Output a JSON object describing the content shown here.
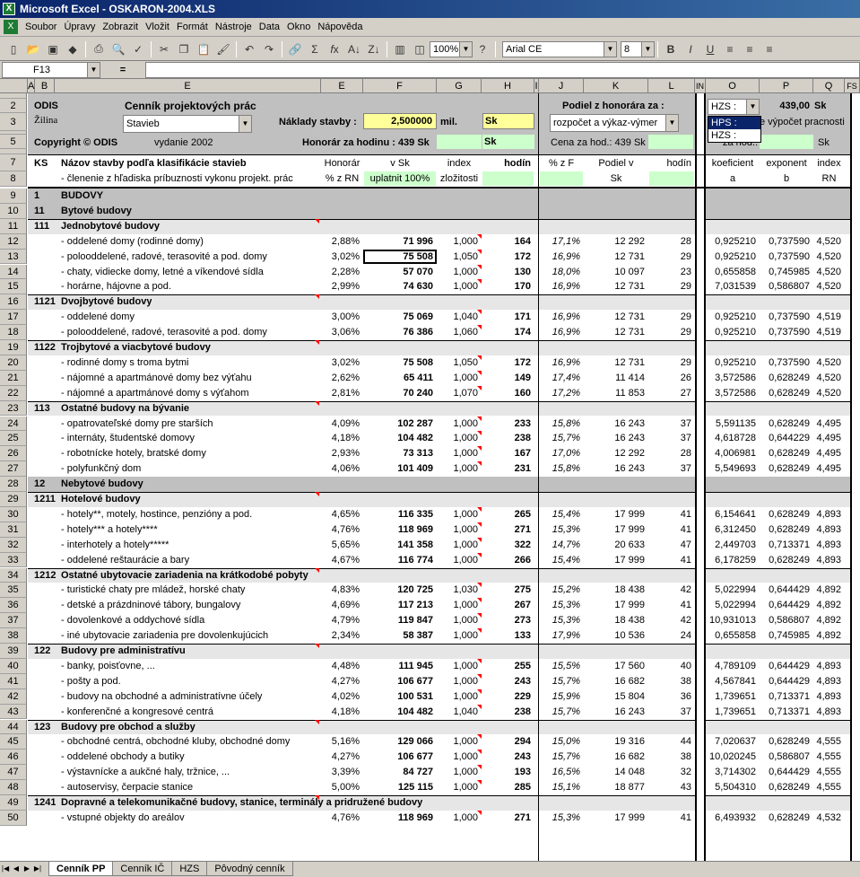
{
  "window": {
    "title": "Microsoft Excel - OSKARON-2004.XLS"
  },
  "menu": [
    "Soubor",
    "Úpravy",
    "Zobrazit",
    "Vložit",
    "Formát",
    "Nástroje",
    "Data",
    "Okno",
    "Nápověda"
  ],
  "toolbar": {
    "zoom": "100%",
    "font": "Arial CE",
    "size": "8"
  },
  "formula": {
    "cell_ref": "F13",
    "eq": "="
  },
  "columns": [
    "A",
    "B",
    "C",
    "D",
    "E",
    "F",
    "G",
    "H",
    "I",
    "J",
    "K",
    "L",
    "IN",
    "O",
    "P",
    "Q",
    "FS"
  ],
  "header": {
    "odis": "ODIS",
    "zilina": "Žilina",
    "cennik": "Cenník projektových prác",
    "stavieb": "Stavieb",
    "naklady_label": "Náklady stavby :",
    "naklady_value": "2,500000",
    "mil": "mil.",
    "sk": "Sk",
    "copyright": "Copyright © ODIS",
    "vydanie": "vydanie 2002",
    "honorar_label": "Honorár za hodinu : 439 Sk",
    "sk2": "Sk",
    "podiel_label": "Podiel z honorára za :",
    "podiel_value": "rozpočet a výkaz-výmer",
    "cena_label": "Cena za hod.: 439 Sk",
    "hzs_value": "HZS :",
    "hzs_price": "439,00",
    "hzs_sk": "Sk",
    "vypocet": "e výpočet pracnosti",
    "za_hod": "za hod.:",
    "sk3": "Sk",
    "dropdown_items": [
      "HPS :",
      "HZS :"
    ]
  },
  "colheads": {
    "ks": "KS",
    "nazov": "Názov stavby podľa klasifikácie stavieb",
    "clenenie": "- členenie z hľadiska príbuznosti vykonu projekt. prác",
    "honorar1": "Honorár",
    "honorar2": "% z RN",
    "vsk": "v Sk",
    "uplatnit": "uplatnit 100%",
    "index1": "index",
    "index2": "zložitosti",
    "hodin": "hodín",
    "pzf": "% z F",
    "podiel1": "Podiel v",
    "podiel2": "Sk",
    "hodin2": "hodín",
    "koef1": "koeficient",
    "koef2": "a",
    "exp1": "exponent",
    "exp2": "b",
    "ind1": "index",
    "ind2": "RN"
  },
  "rows": [
    {
      "n": "9",
      "t": "band",
      "ks": "1",
      "name": "BUDOVY"
    },
    {
      "n": "10",
      "t": "band",
      "ks": "11",
      "name": "Bytové budovy"
    },
    {
      "n": "11",
      "t": "group",
      "ks": "111",
      "name": "Jednobytové budovy"
    },
    {
      "n": "12",
      "t": "data",
      "name": "- oddelené domy (rodinné domy)",
      "e": "2,88%",
      "f": "71 996",
      "g": "1,000",
      "h": "164",
      "j": "17,1%",
      "k": "12 292",
      "l": "28",
      "o": "0,925210",
      "p": "0,737590",
      "q": "4,520"
    },
    {
      "n": "13",
      "t": "data",
      "name": "- polooddelené, radové, terasovité a pod. domy",
      "e": "3,02%",
      "f": "75 508",
      "g": "1,050",
      "h": "172",
      "j": "16,9%",
      "k": "12 731",
      "l": "29",
      "o": "0,925210",
      "p": "0,737590",
      "q": "4,520",
      "sel": true
    },
    {
      "n": "14",
      "t": "data",
      "name": "- chaty, vidiecke domy, letné a víkendové sídla",
      "e": "2,28%",
      "f": "57 070",
      "g": "1,000",
      "h": "130",
      "j": "18,0%",
      "k": "10 097",
      "l": "23",
      "o": "0,655858",
      "p": "0,745985",
      "q": "4,520"
    },
    {
      "n": "15",
      "t": "data",
      "name": "- horárne, hájovne a pod.",
      "e": "2,99%",
      "f": "74 630",
      "g": "1,000",
      "h": "170",
      "j": "16,9%",
      "k": "12 731",
      "l": "29",
      "o": "7,031539",
      "p": "0,586807",
      "q": "4,520"
    },
    {
      "n": "16",
      "t": "group",
      "ks": "1121",
      "name": "Dvojbytové budovy"
    },
    {
      "n": "17",
      "t": "data",
      "name": "- oddelené domy",
      "e": "3,00%",
      "f": "75 069",
      "g": "1,040",
      "h": "171",
      "j": "16,9%",
      "k": "12 731",
      "l": "29",
      "o": "0,925210",
      "p": "0,737590",
      "q": "4,519"
    },
    {
      "n": "18",
      "t": "data",
      "name": "- polooddelené, radové, terasovité a pod. domy",
      "e": "3,06%",
      "f": "76 386",
      "g": "1,060",
      "h": "174",
      "j": "16,9%",
      "k": "12 731",
      "l": "29",
      "o": "0,925210",
      "p": "0,737590",
      "q": "4,519"
    },
    {
      "n": "19",
      "t": "group",
      "ks": "1122",
      "name": "Trojbytové a viacbytové budovy"
    },
    {
      "n": "20",
      "t": "data",
      "name": "- rodinné domy s troma bytmi",
      "e": "3,02%",
      "f": "75 508",
      "g": "1,050",
      "h": "172",
      "j": "16,9%",
      "k": "12 731",
      "l": "29",
      "o": "0,925210",
      "p": "0,737590",
      "q": "4,520"
    },
    {
      "n": "21",
      "t": "data",
      "name": "- nájomné a apartmánové domy bez výťahu",
      "e": "2,62%",
      "f": "65 411",
      "g": "1,000",
      "h": "149",
      "j": "17,4%",
      "k": "11 414",
      "l": "26",
      "o": "3,572586",
      "p": "0,628249",
      "q": "4,520"
    },
    {
      "n": "22",
      "t": "data",
      "name": "- nájomné a apartmánové domy s výťahom",
      "e": "2,81%",
      "f": "70 240",
      "g": "1,070",
      "h": "160",
      "j": "17,2%",
      "k": "11 853",
      "l": "27",
      "o": "3,572586",
      "p": "0,628249",
      "q": "4,520"
    },
    {
      "n": "23",
      "t": "group",
      "ks": "113",
      "name": "Ostatné budovy na bývanie"
    },
    {
      "n": "24",
      "t": "data",
      "name": "- opatrovateľské domy pre starších",
      "e": "4,09%",
      "f": "102 287",
      "g": "1,000",
      "h": "233",
      "j": "15,8%",
      "k": "16 243",
      "l": "37",
      "o": "5,591135",
      "p": "0,628249",
      "q": "4,495"
    },
    {
      "n": "25",
      "t": "data",
      "name": "- internáty, študentské domovy",
      "e": "4,18%",
      "f": "104 482",
      "g": "1,000",
      "h": "238",
      "j": "15,7%",
      "k": "16 243",
      "l": "37",
      "o": "4,618728",
      "p": "0,644229",
      "q": "4,495"
    },
    {
      "n": "26",
      "t": "data",
      "name": "- robotnícke hotely, bratské domy",
      "e": "2,93%",
      "f": "73 313",
      "g": "1,000",
      "h": "167",
      "j": "17,0%",
      "k": "12 292",
      "l": "28",
      "o": "4,006981",
      "p": "0,628249",
      "q": "4,495"
    },
    {
      "n": "27",
      "t": "data",
      "name": "- polyfunkčný dom",
      "e": "4,06%",
      "f": "101 409",
      "g": "1,000",
      "h": "231",
      "j": "15,8%",
      "k": "16 243",
      "l": "37",
      "o": "5,549693",
      "p": "0,628249",
      "q": "4,495"
    },
    {
      "n": "28",
      "t": "band",
      "ks": "12",
      "name": "Nebytové budovy"
    },
    {
      "n": "29",
      "t": "group",
      "ks": "1211",
      "name": "Hotelové budovy"
    },
    {
      "n": "30",
      "t": "data",
      "name": "- hotely**, motely, hostince, penzióny a pod.",
      "e": "4,65%",
      "f": "116 335",
      "g": "1,000",
      "h": "265",
      "j": "15,4%",
      "k": "17 999",
      "l": "41",
      "o": "6,154641",
      "p": "0,628249",
      "q": "4,893"
    },
    {
      "n": "31",
      "t": "data",
      "name": "- hotely*** a hotely****",
      "e": "4,76%",
      "f": "118 969",
      "g": "1,000",
      "h": "271",
      "j": "15,3%",
      "k": "17 999",
      "l": "41",
      "o": "6,312450",
      "p": "0,628249",
      "q": "4,893"
    },
    {
      "n": "32",
      "t": "data",
      "name": "- interhotely a hotely*****",
      "e": "5,65%",
      "f": "141 358",
      "g": "1,000",
      "h": "322",
      "j": "14,7%",
      "k": "20 633",
      "l": "47",
      "o": "2,449703",
      "p": "0,713371",
      "q": "4,893"
    },
    {
      "n": "33",
      "t": "data",
      "name": "- oddelené reštaurácie a bary",
      "e": "4,67%",
      "f": "116 774",
      "g": "1,000",
      "h": "266",
      "j": "15,4%",
      "k": "17 999",
      "l": "41",
      "o": "6,178259",
      "p": "0,628249",
      "q": "4,893"
    },
    {
      "n": "34",
      "t": "group",
      "ks": "1212",
      "name": "Ostatné ubytovacie zariadenia na krátkodobé pobyty"
    },
    {
      "n": "35",
      "t": "data",
      "name": "- turistické chaty pre mládež, horské chaty",
      "e": "4,83%",
      "f": "120 725",
      "g": "1,030",
      "h": "275",
      "j": "15,2%",
      "k": "18 438",
      "l": "42",
      "o": "5,022994",
      "p": "0,644429",
      "q": "4,892"
    },
    {
      "n": "36",
      "t": "data",
      "name": "- detské a prázdninové tábory, bungalovy",
      "e": "4,69%",
      "f": "117 213",
      "g": "1,000",
      "h": "267",
      "j": "15,3%",
      "k": "17 999",
      "l": "41",
      "o": "5,022994",
      "p": "0,644429",
      "q": "4,892"
    },
    {
      "n": "37",
      "t": "data",
      "name": "- dovolenkové a oddychové sídla",
      "e": "4,79%",
      "f": "119 847",
      "g": "1,000",
      "h": "273",
      "j": "15,3%",
      "k": "18 438",
      "l": "42",
      "o": "10,931013",
      "p": "0,586807",
      "q": "4,892"
    },
    {
      "n": "38",
      "t": "data",
      "name": "- iné ubytovacie zariadenia pre dovolenkujúcich",
      "e": "2,34%",
      "f": "58 387",
      "g": "1,000",
      "h": "133",
      "j": "17,9%",
      "k": "10 536",
      "l": "24",
      "o": "0,655858",
      "p": "0,745985",
      "q": "4,892"
    },
    {
      "n": "39",
      "t": "group",
      "ks": "122",
      "name": "Budovy pre administratívu"
    },
    {
      "n": "40",
      "t": "data",
      "name": "- banky, poisťovne, ...",
      "e": "4,48%",
      "f": "111 945",
      "g": "1,000",
      "h": "255",
      "j": "15,5%",
      "k": "17 560",
      "l": "40",
      "o": "4,789109",
      "p": "0,644429",
      "q": "4,893"
    },
    {
      "n": "41",
      "t": "data",
      "name": "- pošty a pod.",
      "e": "4,27%",
      "f": "106 677",
      "g": "1,000",
      "h": "243",
      "j": "15,7%",
      "k": "16 682",
      "l": "38",
      "o": "4,567841",
      "p": "0,644429",
      "q": "4,893"
    },
    {
      "n": "42",
      "t": "data",
      "name": "- budovy na obchodné a administratívne účely",
      "e": "4,02%",
      "f": "100 531",
      "g": "1,000",
      "h": "229",
      "j": "15,9%",
      "k": "15 804",
      "l": "36",
      "o": "1,739651",
      "p": "0,713371",
      "q": "4,893"
    },
    {
      "n": "43",
      "t": "data",
      "name": "- konferenčné a kongresové centrá",
      "e": "4,18%",
      "f": "104 482",
      "g": "1,040",
      "h": "238",
      "j": "15,7%",
      "k": "16 243",
      "l": "37",
      "o": "1,739651",
      "p": "0,713371",
      "q": "4,893"
    },
    {
      "n": "44",
      "t": "group",
      "ks": "123",
      "name": "Budovy pre obchod a služby"
    },
    {
      "n": "45",
      "t": "data",
      "name": "- obchodné centrá, obchodné kluby, obchodné domy",
      "e": "5,16%",
      "f": "129 066",
      "g": "1,000",
      "h": "294",
      "j": "15,0%",
      "k": "19 316",
      "l": "44",
      "o": "7,020637",
      "p": "0,628249",
      "q": "4,555"
    },
    {
      "n": "46",
      "t": "data",
      "name": "- oddelené obchody a butiky",
      "e": "4,27%",
      "f": "106 677",
      "g": "1,000",
      "h": "243",
      "j": "15,7%",
      "k": "16 682",
      "l": "38",
      "o": "10,020245",
      "p": "0,586807",
      "q": "4,555"
    },
    {
      "n": "47",
      "t": "data",
      "name": "- výstavnícke a aukčné haly, tržnice, ...",
      "e": "3,39%",
      "f": "84 727",
      "g": "1,000",
      "h": "193",
      "j": "16,5%",
      "k": "14 048",
      "l": "32",
      "o": "3,714302",
      "p": "0,644429",
      "q": "4,555"
    },
    {
      "n": "48",
      "t": "data",
      "name": "- autoservisy, čerpacie stanice",
      "e": "5,00%",
      "f": "125 115",
      "g": "1,000",
      "h": "285",
      "j": "15,1%",
      "k": "18 877",
      "l": "43",
      "o": "5,504310",
      "p": "0,628249",
      "q": "4,555"
    },
    {
      "n": "49",
      "t": "group",
      "ks": "1241",
      "name": "Dopravné a telekomunikačné budovy, stanice, terminály a pridružené budovy"
    },
    {
      "n": "50",
      "t": "data",
      "name": "- vstupné objekty do areálov",
      "e": "4,76%",
      "f": "118 969",
      "g": "1,000",
      "h": "271",
      "j": "15,3%",
      "k": "17 999",
      "l": "41",
      "o": "6,493932",
      "p": "0,628249",
      "q": "4,532"
    }
  ],
  "sheet_tabs": [
    "Cenník PP",
    "Cenník IČ",
    "HZS",
    "Pôvodný cenník"
  ]
}
